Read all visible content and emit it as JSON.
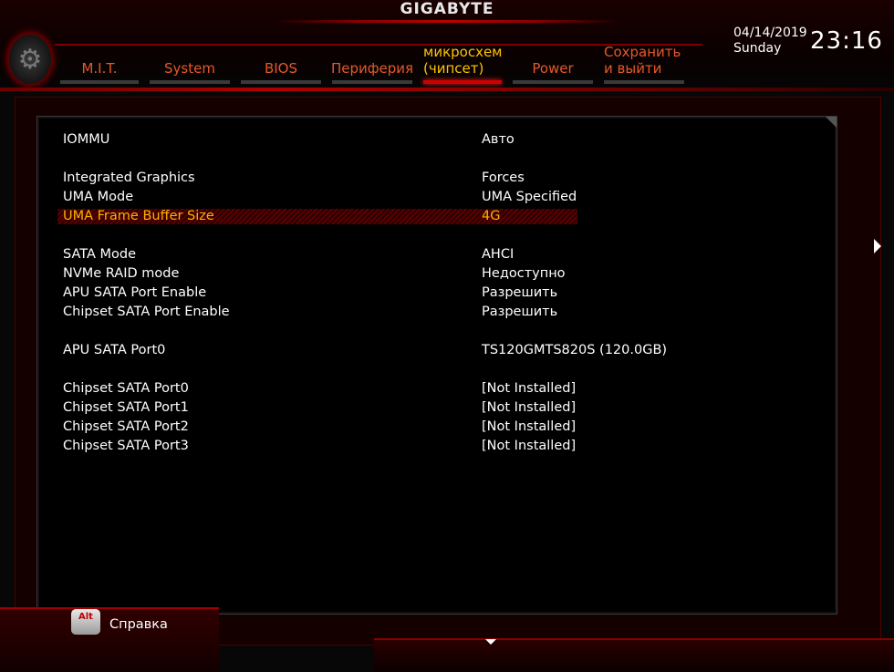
{
  "header": {
    "brand": "GIGABYTE",
    "date": "04/14/2019",
    "weekday": "Sunday",
    "time": "23:16"
  },
  "tabs": [
    {
      "label": "M.I.T."
    },
    {
      "label": "System"
    },
    {
      "label": "BIOS"
    },
    {
      "label": "Периферия"
    },
    {
      "line1": "микросхем",
      "line2": "(чипсет)",
      "active": true
    },
    {
      "label": "Power"
    },
    {
      "line1": "Сохранить",
      "line2": "и выйти"
    }
  ],
  "settings": [
    {
      "label": "IOMMU",
      "value": "Авто"
    },
    {
      "label": "Integrated Graphics",
      "value": "Forces"
    },
    {
      "label": "UMA Mode",
      "value": "UMA Specified"
    },
    {
      "label": "UMA Frame Buffer Size",
      "value": "4G",
      "selected": true
    },
    {
      "label": "SATA Mode",
      "value": "AHCI"
    },
    {
      "label": "NVMe RAID mode",
      "value": "Недоступно"
    },
    {
      "label": "APU SATA Port Enable",
      "value": "Разрешить"
    },
    {
      "label": "Chipset SATA Port Enable",
      "value": "Разрешить"
    },
    {
      "label": "APU SATA Port0",
      "value": "TS120GMTS820S  (120.0GB)"
    },
    {
      "label": "Chipset SATA Port0",
      "value": "[Not Installed]"
    },
    {
      "label": "Chipset SATA Port1",
      "value": "[Not Installed]"
    },
    {
      "label": "Chipset SATA Port2",
      "value": "[Not Installed]"
    },
    {
      "label": "Chipset SATA Port3",
      "value": "[Not Installed]"
    }
  ],
  "footer": {
    "alt_key": "Alt",
    "help_label": "Справка"
  },
  "colors": {
    "accent": "#d00000",
    "tab_text": "#e25a2a",
    "active_tab_text": "#ffc400",
    "selected_row_text": "#ffb000"
  }
}
